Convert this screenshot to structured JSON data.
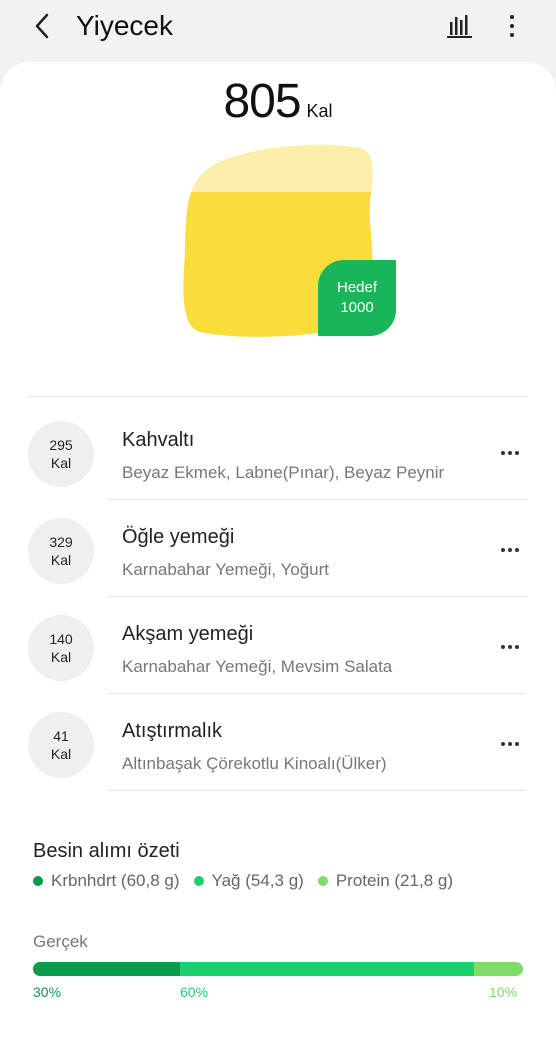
{
  "header": {
    "title": "Yiyecek"
  },
  "summary": {
    "kcal_value": "805",
    "kcal_unit": "Kal",
    "goal_label": "Hedef",
    "goal_value": "1000"
  },
  "meals": [
    {
      "kcal": "295",
      "unit": "Kal",
      "name": "Kahvaltı",
      "items": "Beyaz Ekmek, Labne(Pınar), Beyaz Peynir"
    },
    {
      "kcal": "329",
      "unit": "Kal",
      "name": "Öğle yemeği",
      "items": "Karnabahar Yemeği, Yoğurt"
    },
    {
      "kcal": "140",
      "unit": "Kal",
      "name": "Akşam yemeği",
      "items": "Karnabahar Yemeği, Mevsim Salata"
    },
    {
      "kcal": "41",
      "unit": "Kal",
      "name": "Atıştırmalık",
      "items": "Altınbaşak Çörekotlu Kinoalı(Ülker)"
    }
  ],
  "nutrition": {
    "title": "Besin alımı özeti",
    "legend": [
      {
        "label": "Krbnhdrt (60,8 g)",
        "color": "#0e9a4c"
      },
      {
        "label": "Yağ (54,3 g)",
        "color": "#1fcf6e"
      },
      {
        "label": "Protein (21,8 g)",
        "color": "#7fdc64"
      }
    ],
    "actual_label": "Gerçek",
    "bar": [
      {
        "label": "30%",
        "percent": 30,
        "color": "#0e9a4c"
      },
      {
        "label": "60%",
        "percent": 60,
        "color": "#1fcf6e"
      },
      {
        "label": "10%",
        "percent": 10,
        "color": "#7fdc64"
      }
    ]
  }
}
